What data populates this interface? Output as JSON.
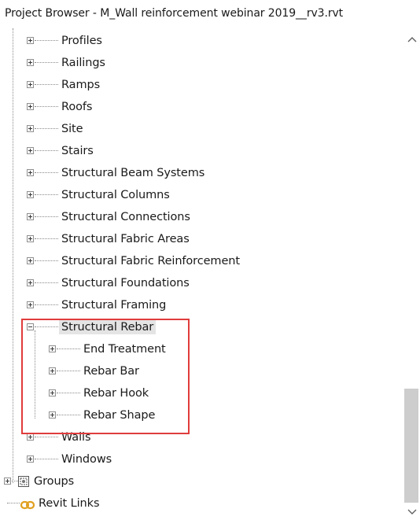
{
  "window": {
    "title": "Project Browser - M_Wall reinforcement webinar 2019__rv3.rvt"
  },
  "tree": {
    "items": [
      {
        "label": "Profiles",
        "level": 2,
        "expander": "plus"
      },
      {
        "label": "Railings",
        "level": 2,
        "expander": "plus"
      },
      {
        "label": "Ramps",
        "level": 2,
        "expander": "plus"
      },
      {
        "label": "Roofs",
        "level": 2,
        "expander": "plus"
      },
      {
        "label": "Site",
        "level": 2,
        "expander": "plus"
      },
      {
        "label": "Stairs",
        "level": 2,
        "expander": "plus"
      },
      {
        "label": "Structural Beam Systems",
        "level": 2,
        "expander": "plus"
      },
      {
        "label": "Structural Columns",
        "level": 2,
        "expander": "plus"
      },
      {
        "label": "Structural Connections",
        "level": 2,
        "expander": "plus"
      },
      {
        "label": "Structural Fabric Areas",
        "level": 2,
        "expander": "plus"
      },
      {
        "label": "Structural Fabric Reinforcement",
        "level": 2,
        "expander": "plus"
      },
      {
        "label": "Structural Foundations",
        "level": 2,
        "expander": "plus"
      },
      {
        "label": "Structural Framing",
        "level": 2,
        "expander": "plus"
      },
      {
        "label": "Structural Rebar",
        "level": 2,
        "expander": "minus",
        "selected": true
      },
      {
        "label": "End Treatment",
        "level": 3,
        "expander": "plus"
      },
      {
        "label": "Rebar Bar",
        "level": 3,
        "expander": "plus"
      },
      {
        "label": "Rebar Hook",
        "level": 3,
        "expander": "plus"
      },
      {
        "label": "Rebar Shape",
        "level": 3,
        "expander": "plus"
      },
      {
        "label": "Walls",
        "level": 2,
        "expander": "plus"
      },
      {
        "label": "Windows",
        "level": 2,
        "expander": "plus"
      },
      {
        "label": "Groups",
        "level": 1,
        "expander": "plus",
        "icon": "groups-icon"
      },
      {
        "label": "Revit Links",
        "level": 1,
        "expander": "none",
        "icon": "revit-links-icon"
      }
    ]
  },
  "icons": {
    "groups": "groups-icon",
    "revit_links": "revit-links-icon",
    "scroll_up": "chevron-up-icon",
    "scroll_down": "chevron-down-icon"
  },
  "colors": {
    "highlight_box": "#e03c3c",
    "selection_bg": "#e4e4e4",
    "link_icon": "#e0a020"
  }
}
